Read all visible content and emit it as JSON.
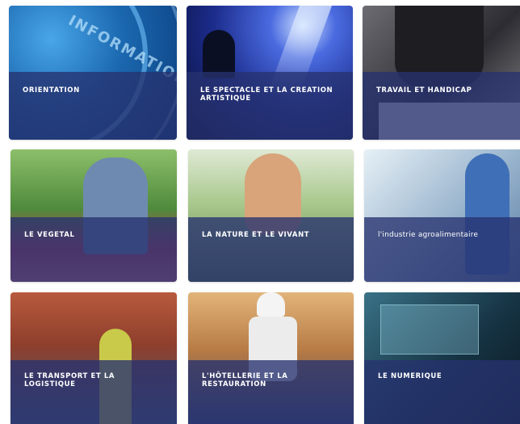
{
  "tiles": [
    {
      "label": "ORIENTATION",
      "image_text": "INFORMATION",
      "colors": [
        "#1f6fb8",
        "#0a3a7a"
      ]
    },
    {
      "label": "LE SPECTACLE ET LA CREATION ARTISTIQUE",
      "colors": [
        "#2a48b8",
        "#0b1340"
      ]
    },
    {
      "label": "TRAVAIL ET HANDICAP",
      "colors": [
        "#5a5a60",
        "#1a1a1e"
      ]
    },
    {
      "label": "LE VEGETAL",
      "colors": [
        "#6a9c4c",
        "#c8405a"
      ]
    },
    {
      "label": "LA NATURE ET LE VIVANT",
      "colors": [
        "#a7c98a",
        "#4a6a3a"
      ]
    },
    {
      "label": "l'industrie agroalimentaire",
      "colors": [
        "#cfe2ee",
        "#6f8fb0"
      ]
    },
    {
      "label": "LE TRANSPORT ET LA LOGISTIQUE",
      "colors": [
        "#a14a32",
        "#3c4f6a"
      ]
    },
    {
      "label": "L'HÔTELLERIE ET LA RESTAURATION",
      "colors": [
        "#c78a4a",
        "#2e3f6b"
      ]
    },
    {
      "label": "LE NUMERIQUE",
      "colors": [
        "#2d5a6e",
        "#0e1e28"
      ]
    }
  ]
}
